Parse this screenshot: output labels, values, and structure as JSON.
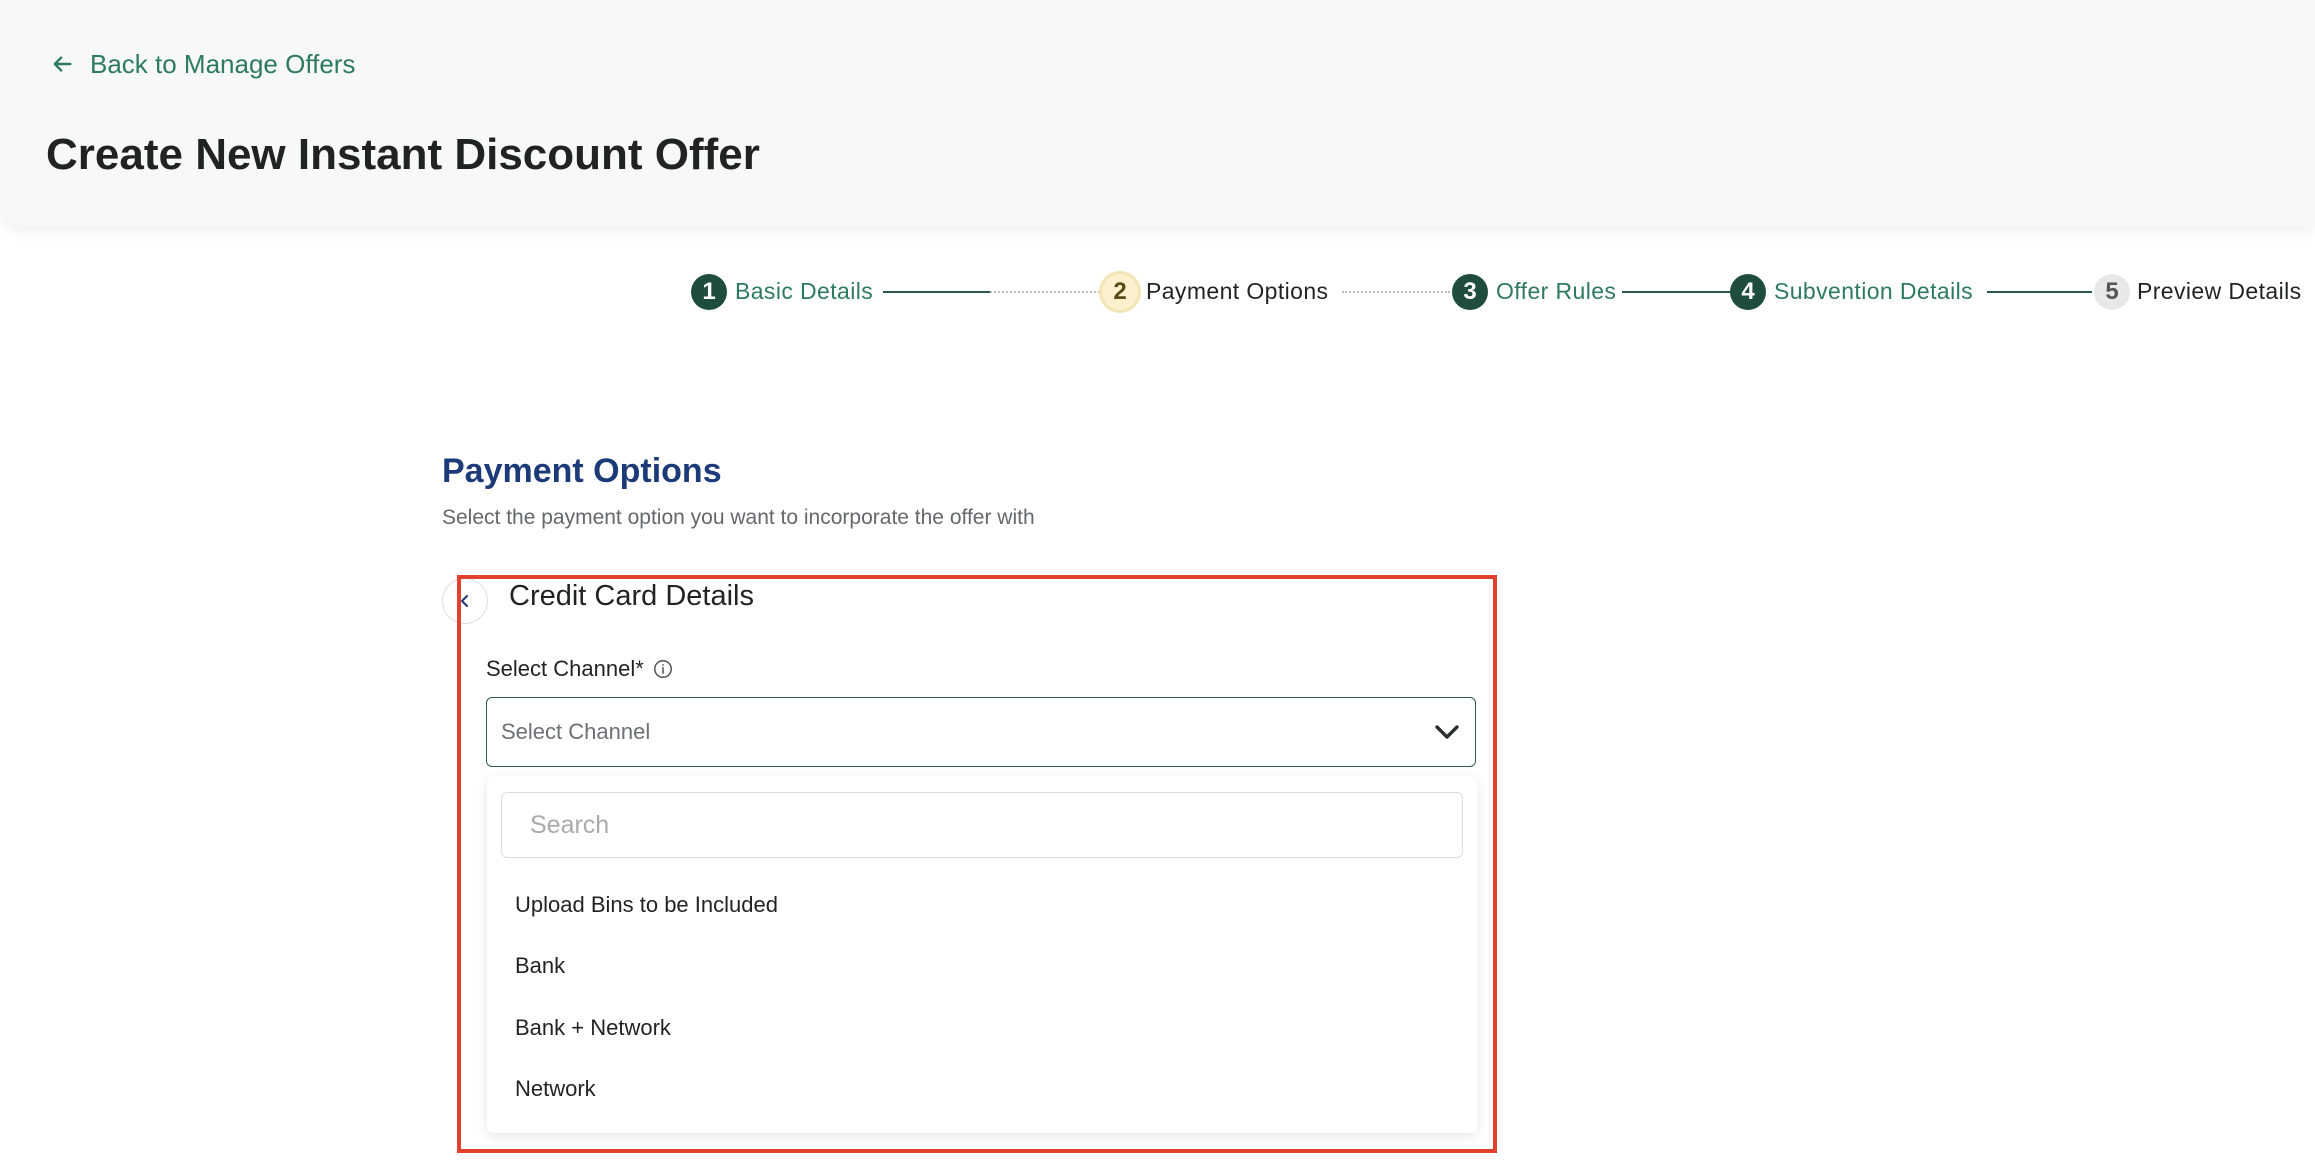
{
  "header": {
    "back_label": "Back to Manage Offers",
    "title": "Create New Instant Discount Offer"
  },
  "stepper": {
    "steps": [
      {
        "number": "1",
        "label": "Basic Details",
        "state": "done"
      },
      {
        "number": "2",
        "label": "Payment Options",
        "state": "current"
      },
      {
        "number": "3",
        "label": "Offer Rules",
        "state": "done"
      },
      {
        "number": "4",
        "label": "Subvention Details",
        "state": "done"
      },
      {
        "number": "5",
        "label": "Preview Details",
        "state": "pending"
      }
    ]
  },
  "section": {
    "title": "Payment Options",
    "subtitle": "Select the payment option you want to incorporate the offer with"
  },
  "card": {
    "title": "Credit Card Details",
    "channel_label": "Select Channel*",
    "channel_placeholder": "Select Channel",
    "search_placeholder": "Search",
    "options": [
      "Upload Bins to be Included",
      "Bank",
      "Bank + Network",
      "Network"
    ]
  },
  "colors": {
    "accent_green": "#2e7a5d",
    "step_dark": "#1e4c3d",
    "section_title": "#1d3a78",
    "highlight": "#e3402e"
  }
}
